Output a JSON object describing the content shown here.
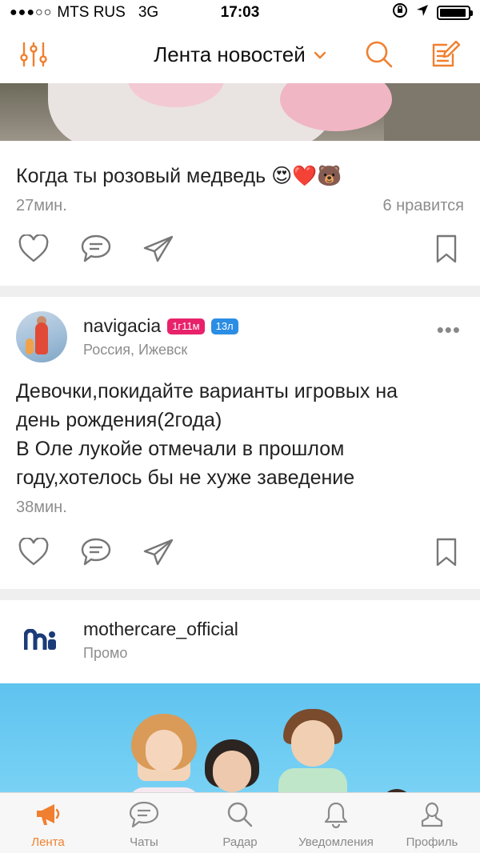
{
  "status_bar": {
    "signal": "●●●○○",
    "carrier": "MTS RUS",
    "network": "3G",
    "time": "17:03",
    "battery_level": 0.95
  },
  "nav": {
    "title": "Лента новостей",
    "accent_color": "#f07f2f"
  },
  "posts": [
    {
      "text": "Когда ты розовый медведь 😍❤️🐻",
      "time": "27мин.",
      "likes": "6 нравится"
    },
    {
      "username": "navigacia",
      "badge_age": "1г11м",
      "badge_years": "13л",
      "location": "Россия, Ижевск",
      "text_line1": "Девочки,покидайте варианты игровых на",
      "text_line2": "день рождения(2года)",
      "text_line3": "В Оле лукойе отмечали в прошлом",
      "text_line4": "году,хотелось бы не хуже заведение",
      "time": "38мин."
    },
    {
      "username": "mothercare_official",
      "subline": "Промо"
    }
  ],
  "tabs": [
    {
      "label": "Лента",
      "icon": "megaphone-icon",
      "active": true
    },
    {
      "label": "Чаты",
      "icon": "chat-icon"
    },
    {
      "label": "Радар",
      "icon": "search-icon"
    },
    {
      "label": "Уведомления",
      "icon": "bell-icon"
    },
    {
      "label": "Профиль",
      "icon": "profile-icon"
    }
  ]
}
